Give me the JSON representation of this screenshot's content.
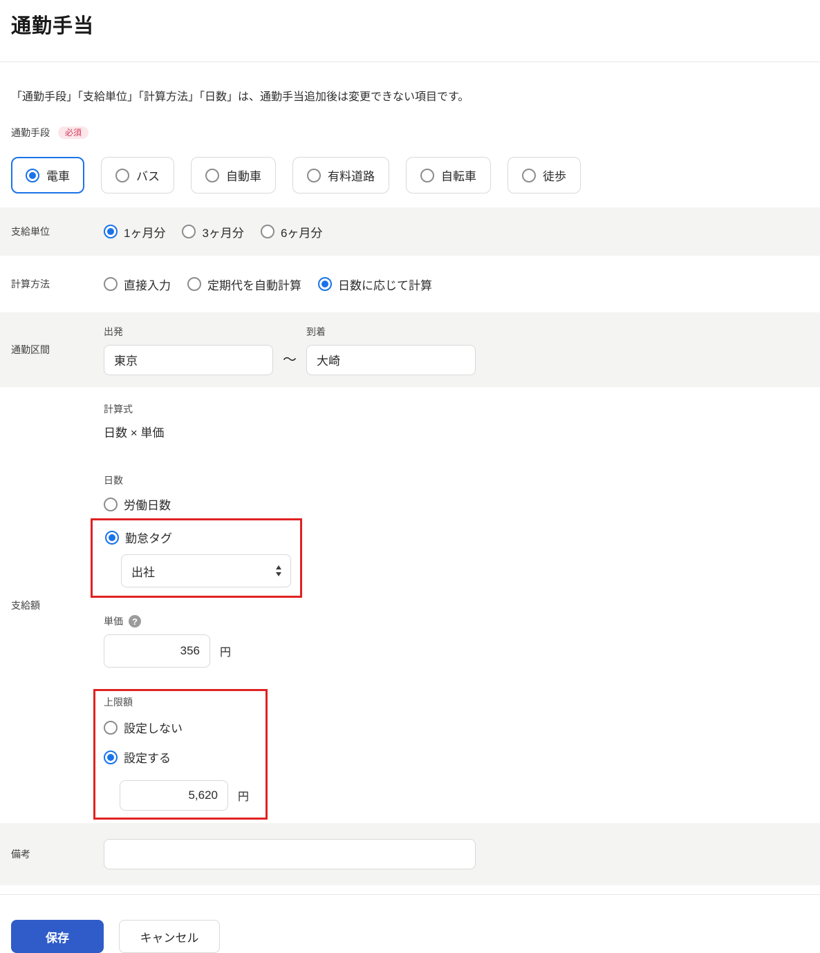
{
  "page": {
    "title": "通勤手当"
  },
  "note": "「通勤手段」「支給単位」「計算方法」「日数」は、通勤手当追加後は変更できない項目です。",
  "commute_method": {
    "label": "通勤手段",
    "required_badge": "必須",
    "options": [
      {
        "label": "電車",
        "selected": true
      },
      {
        "label": "バス",
        "selected": false
      },
      {
        "label": "自動車",
        "selected": false
      },
      {
        "label": "有料道路",
        "selected": false
      },
      {
        "label": "自転車",
        "selected": false
      },
      {
        "label": "徒歩",
        "selected": false
      }
    ]
  },
  "payment_unit": {
    "label": "支給単位",
    "options": [
      {
        "label": "1ヶ月分",
        "selected": true
      },
      {
        "label": "3ヶ月分",
        "selected": false
      },
      {
        "label": "6ヶ月分",
        "selected": false
      }
    ]
  },
  "calc_method": {
    "label": "計算方法",
    "options": [
      {
        "label": "直接入力",
        "selected": false
      },
      {
        "label": "定期代を自動計算",
        "selected": false
      },
      {
        "label": "日数に応じて計算",
        "selected": true
      }
    ]
  },
  "commute_section": {
    "label": "通勤区間",
    "from_label": "出発",
    "from_value": "東京",
    "separator": "〜",
    "to_label": "到着",
    "to_value": "大崎"
  },
  "payment_amount": {
    "label": "支給額",
    "formula_label": "計算式",
    "formula_value": "日数 × 単価",
    "days": {
      "label": "日数",
      "options": [
        {
          "label": "労働日数",
          "selected": false
        },
        {
          "label": "勤怠タグ",
          "selected": true
        }
      ],
      "tag_select_value": "出社"
    },
    "unit_price": {
      "label": "単価",
      "help_icon_glyph": "?",
      "value": "356",
      "currency": "円"
    },
    "limit": {
      "label": "上限額",
      "options": [
        {
          "label": "設定しない",
          "selected": false
        },
        {
          "label": "設定する",
          "selected": true
        }
      ],
      "value": "5,620",
      "currency": "円"
    }
  },
  "remarks": {
    "label": "備考",
    "value": ""
  },
  "footer": {
    "save_label": "保存",
    "cancel_label": "キャンセル"
  },
  "colors": {
    "accent_blue": "#1a73e8",
    "button_blue": "#2f5cc8",
    "highlight_red": "#e02222",
    "required_badge_bg": "#fce6ea",
    "required_badge_text": "#d23b5d",
    "row_gray_bg": "#f4f4f3"
  }
}
